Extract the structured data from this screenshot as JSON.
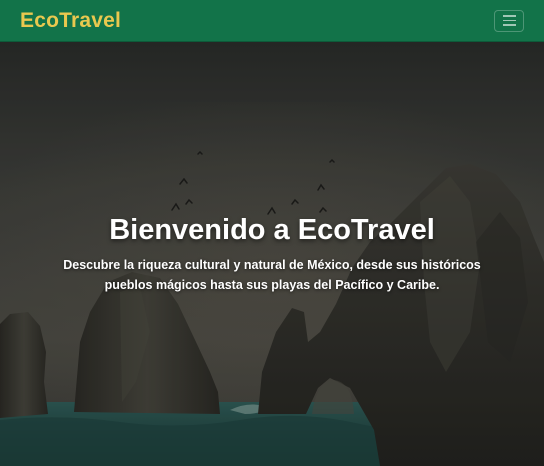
{
  "navbar": {
    "brand": "EcoTravel",
    "menu_icon": "hamburger-menu-icon",
    "brand_color": "#e9c84f",
    "background_color": "#127349"
  },
  "hero": {
    "title": "Bienvenido a EcoTravel",
    "subtitle": "Descubre la riqueza cultural y natural de México, desde sus históricos pueblos mágicos hasta sus playas del Pacífico y Caribe.",
    "background_image": "rock-arch-sea-sunset-image"
  }
}
